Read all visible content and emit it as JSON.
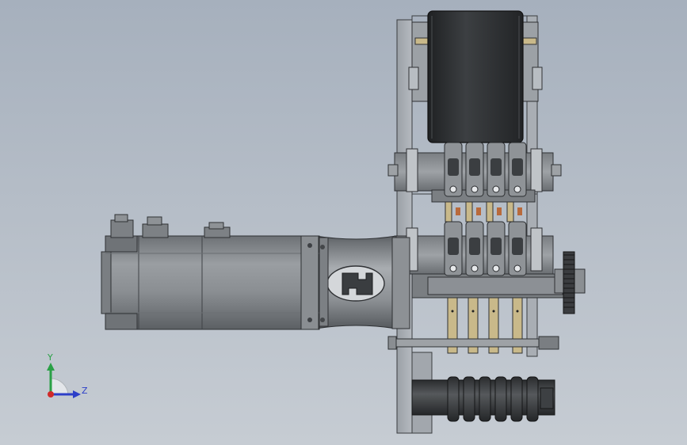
{
  "window": {
    "background_top": "#a6b0bd",
    "background_bottom": "#c6ccd3"
  },
  "colors": {
    "metal": "#8c9196",
    "metal_dark": "#5e6267",
    "rubber": "#2f3134",
    "brass": "#c9b98a",
    "edge": "#2a2c2f",
    "copper": "#b86a3c"
  },
  "triad": {
    "y_label": "Y",
    "z_label": "Z",
    "y_color": "#2aa046",
    "z_color": "#2d3fc8",
    "origin_color": "#d02a2a"
  },
  "parts": {
    "motor": "servo-motor",
    "coupling": "shaft-coupling",
    "frame": "side-plate",
    "roller_top": "drive-roller",
    "roller_bottom": "ribbed-roller",
    "clamp_upper": "wire-clamp-block",
    "clamp_lower": "wire-clamp-block",
    "gear": "spur-gear"
  }
}
